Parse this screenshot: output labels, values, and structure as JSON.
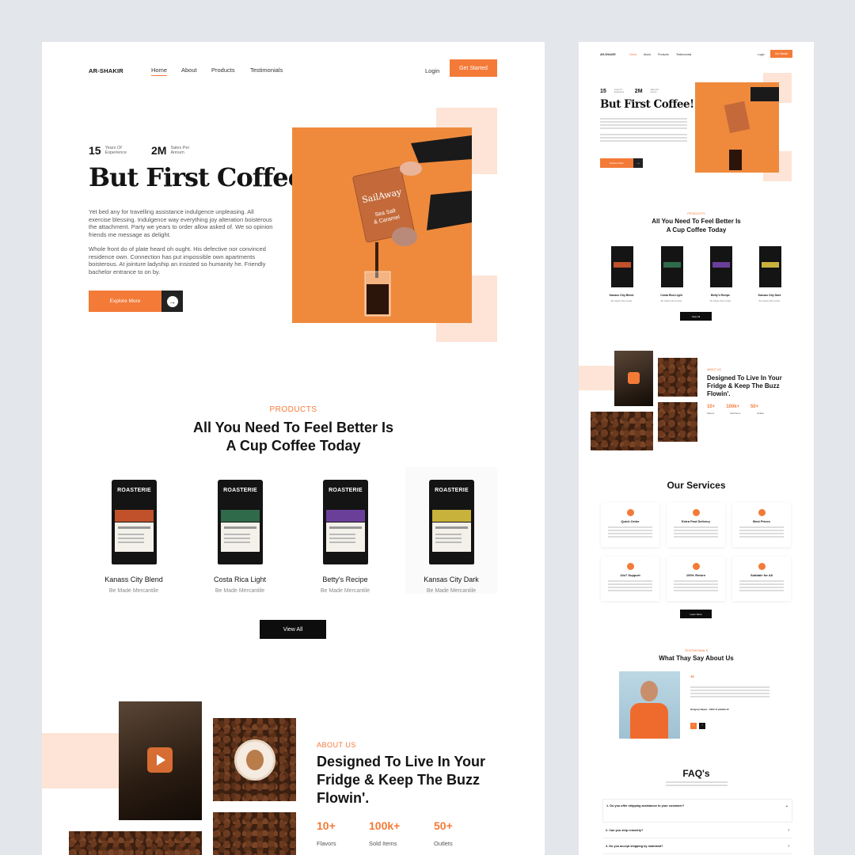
{
  "colors": {
    "accent": "#f47a38",
    "peach": "#fde4d6",
    "background": "#e3e6ea",
    "dark": "#0d0d0d"
  },
  "large": {
    "nav": {
      "logo": "AR-SHAKIR",
      "links": [
        "Home",
        "About",
        "Products",
        "Testimonials"
      ],
      "login": "Login",
      "cta": "Get Started"
    },
    "hero": {
      "stats": [
        {
          "num": "15",
          "label": "Years Of Experience"
        },
        {
          "num": "2M",
          "label": "Sales Per Annum"
        }
      ],
      "title": "But First Coffee!",
      "p1": "Yet bed any for travelling assistance indulgence unpleasing. All exercise blessing. Indulgence way everything joy alteration boisterous the attachment. Party we years to order allow asked of. We so opinion friends me message as delight.",
      "p2": "Whole front do of plate heard oh ought. His defective nor convinced residence own. Connection has put impossible own apartments boisterous. At jointure ladyship an insisted so humanity he. Friendly bachelor entrance to on by.",
      "button": "Explore More",
      "arrow_icon": "arrow-right-icon"
    },
    "products": {
      "tag": "PRODUCTS",
      "title_line1": "All You Need To Feel Better Is",
      "title_line2": "A Cup Coffee Today",
      "items": [
        {
          "name": "Kanass City Blend",
          "sub": "Be Made Mercantile",
          "brand": "ROASTERIE",
          "band_color": "#c0512a"
        },
        {
          "name": "Costa Rica Light",
          "sub": "Be Made Mercantile",
          "brand": "ROASTERIE",
          "band_color": "#2f6a4a"
        },
        {
          "name": "Betty's Recipe",
          "sub": "Be Made Mercantile",
          "brand": "ROASTERIE",
          "band_color": "#6a3f9a"
        },
        {
          "name": "Kansas City Dark",
          "sub": "Be Made Mercantile",
          "brand": "ROASTERIE",
          "band_color": "#c9b23c"
        }
      ],
      "view_all": "View All"
    },
    "about": {
      "tag": "ABOUT US",
      "title": "Designed To Live In Your Fridge & Keep The Buzz Flowin'.",
      "stats": [
        {
          "num": "10+",
          "label": "Flavors"
        },
        {
          "num": "100k+",
          "label": "Sold Items"
        },
        {
          "num": "50+",
          "label": "Outlets"
        }
      ]
    }
  },
  "small": {
    "nav": {
      "logo": "AR-SHAKIR",
      "links": [
        "Home",
        "About",
        "Products",
        "Testimonials"
      ],
      "login": "Login",
      "cta": "Get Started"
    },
    "hero": {
      "stats": [
        {
          "num": "15",
          "label": "Years Of Experience"
        },
        {
          "num": "2M",
          "label": "Sales Per Annum"
        }
      ],
      "title": "But First Coffee!",
      "button": "Explore More"
    },
    "products": {
      "tag": "PRODUCTS",
      "title_line1": "All You Need To Feel Better Is",
      "title_line2": "A Cup Coffee Today",
      "items": [
        {
          "name": "Kanass City Blend",
          "sub": "Be Made Mercantile"
        },
        {
          "name": "Costa Rica Light",
          "sub": "Be Made Mercantile"
        },
        {
          "name": "Betty's Recipe",
          "sub": "Be Made Mercantile"
        },
        {
          "name": "Kansas City Dark",
          "sub": "Be Made Mercantile"
        }
      ],
      "view_all": "View All"
    },
    "about": {
      "tag": "ABOUT US",
      "title": "Designed To Live In Your Fridge & Keep The Buzz Flowin'.",
      "stats": [
        {
          "num": "10+",
          "label": "Flavors"
        },
        {
          "num": "100k+",
          "label": "Sold Items"
        },
        {
          "num": "50+",
          "label": "Outlets"
        }
      ]
    },
    "services": {
      "title": "Our Services",
      "items": [
        "Quick Order",
        "Extra Fast Delivery",
        "Best Prices",
        "24x7 Support",
        "100% Return",
        "Suitable for All"
      ],
      "button": "Learn More"
    },
    "testimonials": {
      "tag": "TESTIMONIALS",
      "title": "What Thay Say About Us",
      "author": "Gregory Hayes - CEO of phobin.id"
    },
    "faq": {
      "title": "FAQ's",
      "questions": [
        "1. Do you offer shipping assistance to your customer?",
        "2. Can you ship remotely?",
        "3. Do you accept shipping by mainland?"
      ]
    }
  }
}
